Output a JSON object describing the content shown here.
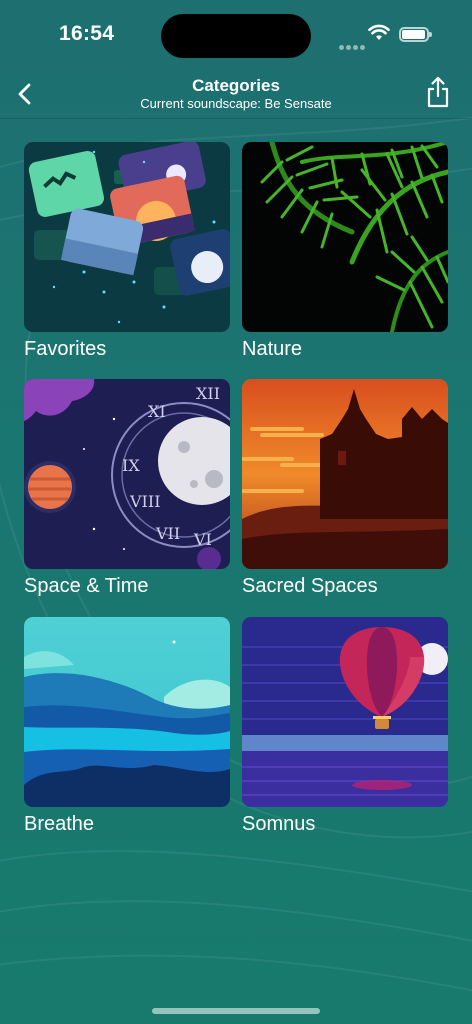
{
  "status_bar": {
    "time": "16:54",
    "wifi_icon": "wifi-icon",
    "battery_icon": "battery-icon"
  },
  "nav": {
    "title": "Categories",
    "subtitle": "Current soundscape: Be Sensate",
    "back_icon": "chevron-left-icon",
    "share_icon": "share-icon"
  },
  "categories": [
    {
      "label": "Favorites"
    },
    {
      "label": "Nature"
    },
    {
      "label": "Space & Time"
    },
    {
      "label": "Sacred Spaces"
    },
    {
      "label": "Breathe"
    },
    {
      "label": "Somnus"
    }
  ]
}
